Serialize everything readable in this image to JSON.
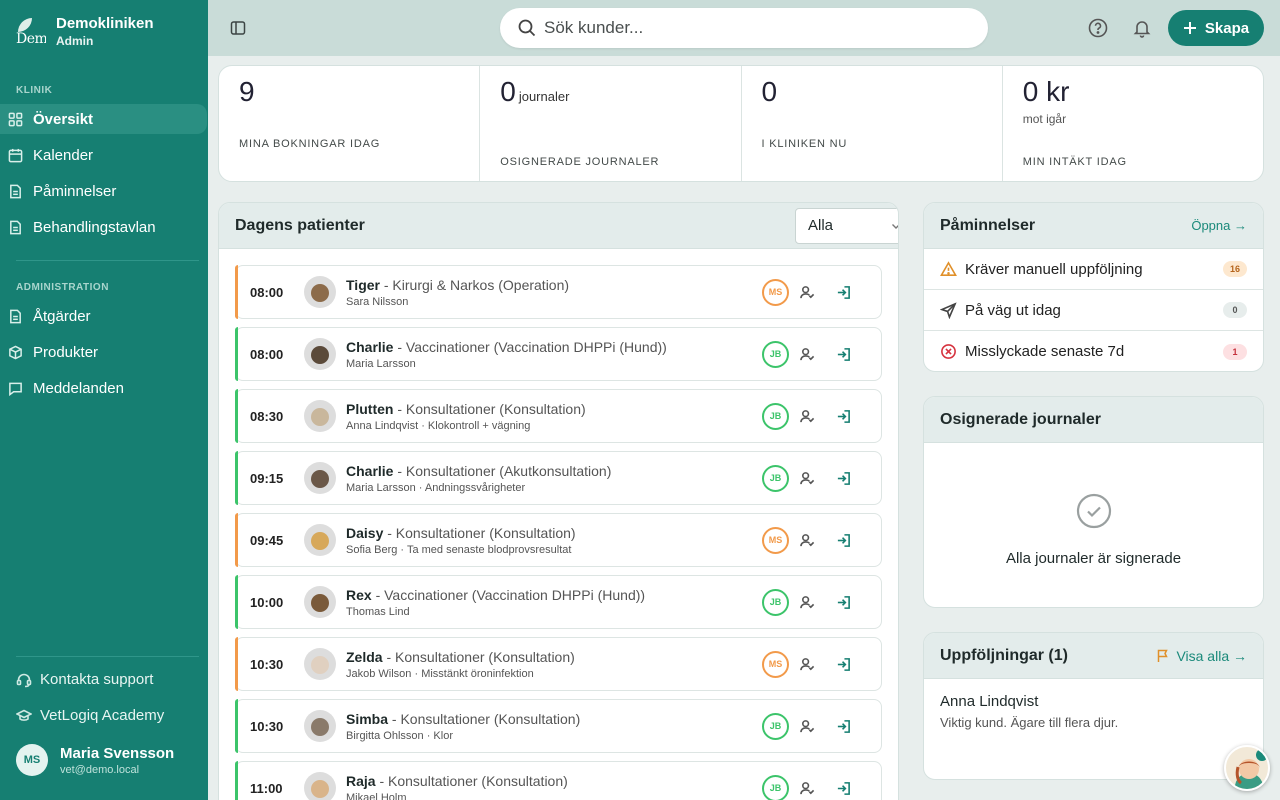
{
  "brand": {
    "name": "Demokliniken",
    "role": "Admin",
    "logo_word": "Dem"
  },
  "sidebar": {
    "section_clinic": "KLINIK",
    "section_admin": "ADMINISTRATION",
    "clinic_items": [
      {
        "label": "Översikt",
        "icon": "grid-icon",
        "active": true
      },
      {
        "label": "Kalender",
        "icon": "calendar-icon"
      },
      {
        "label": "Påminnelser",
        "icon": "document-icon"
      },
      {
        "label": "Behandlingstavlan",
        "icon": "document-icon"
      }
    ],
    "admin_items": [
      {
        "label": "Åtgärder",
        "icon": "document-icon"
      },
      {
        "label": "Produkter",
        "icon": "box-icon"
      },
      {
        "label": "Meddelanden",
        "icon": "chat-icon"
      }
    ],
    "support": "Kontakta support",
    "academy": "VetLogiq Academy",
    "user": {
      "initials": "MS",
      "name": "Maria Svensson",
      "email": "vet@demo.local"
    }
  },
  "topbar": {
    "search_placeholder": "Sök kunder...",
    "create_label": "Skapa"
  },
  "stats": [
    {
      "value": "9",
      "suffix": "",
      "sub": "",
      "label": "MINA BOKNINGAR IDAG"
    },
    {
      "value": "0",
      "suffix": "journaler",
      "sub": "",
      "label": "OSIGNERADE JOURNALER"
    },
    {
      "value": "0",
      "suffix": "",
      "sub": "",
      "label": "I KLINIKEN NU"
    },
    {
      "value": "0 kr",
      "suffix": "",
      "sub": "mot igår",
      "label": "MIN INTÄKT IDAG"
    }
  ],
  "patients": {
    "title": "Dagens patienter",
    "filter": "Alla",
    "rows": [
      {
        "time": "08:00",
        "pet": "Tiger",
        "service": " - Kirurgi & Narkos (Operation)",
        "owner": "Sara Nilsson",
        "vet": "MS",
        "status": "orange"
      },
      {
        "time": "08:00",
        "pet": "Charlie",
        "service": " - Vaccinationer (Vaccination DHPPi (Hund))",
        "owner": "Maria Larsson",
        "vet": "JB",
        "status": "green"
      },
      {
        "time": "08:30",
        "pet": "Plutten",
        "service": " - Konsultationer (Konsultation)",
        "owner": "Anna Lindqvist · Klokontroll + vägning",
        "vet": "JB",
        "status": "green"
      },
      {
        "time": "09:15",
        "pet": "Charlie",
        "service": " - Konsultationer (Akutkonsultation)",
        "owner": "Maria Larsson · Andningssvårigheter",
        "vet": "JB",
        "status": "green"
      },
      {
        "time": "09:45",
        "pet": "Daisy",
        "service": " - Konsultationer (Konsultation)",
        "owner": "Sofia Berg · Ta med senaste blodprovsresultat",
        "vet": "MS",
        "status": "orange"
      },
      {
        "time": "10:00",
        "pet": "Rex",
        "service": " - Vaccinationer (Vaccination DHPPi (Hund))",
        "owner": "Thomas Lind",
        "vet": "JB",
        "status": "green"
      },
      {
        "time": "10:30",
        "pet": "Zelda",
        "service": " - Konsultationer (Konsultation)",
        "owner": "Jakob Wilson · Misstänkt öroninfektion",
        "vet": "MS",
        "status": "orange"
      },
      {
        "time": "10:30",
        "pet": "Simba",
        "service": " - Konsultationer (Konsultation)",
        "owner": "Birgitta Ohlsson · Klor",
        "vet": "JB",
        "status": "green"
      },
      {
        "time": "11:00",
        "pet": "Raja",
        "service": " - Konsultationer (Konsultation)",
        "owner": "Mikael Holm",
        "vet": "JB",
        "status": "green"
      }
    ]
  },
  "reminders": {
    "title": "Påminnelser",
    "open_link": "Öppna →",
    "items": [
      {
        "label": "Kräver manuell uppföljning",
        "count": "16",
        "kind": "warning"
      },
      {
        "label": "På väg ut idag",
        "count": "0",
        "kind": "send"
      },
      {
        "label": "Misslyckade senaste 7d",
        "count": "1",
        "kind": "error"
      }
    ]
  },
  "unsigned": {
    "title": "Osignerade journaler",
    "message": "Alla journaler är signerade"
  },
  "followups": {
    "title": "Uppföljningar (1)",
    "show_all": "Visa alla →",
    "items": [
      {
        "name": "Anna Lindqvist",
        "note": "Viktig kund. Ägare till flera djur."
      }
    ]
  },
  "colors": {
    "primary": "#167f72",
    "orange": "#f29a4a",
    "green": "#3cc46a"
  }
}
